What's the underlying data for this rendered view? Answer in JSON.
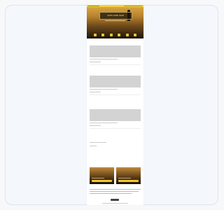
{
  "hero": {
    "title": "EXPLORE MAP"
  },
  "nav": {
    "items": [
      "home-icon",
      "map-icon",
      "calendar-icon",
      "star-icon",
      "food-icon",
      "info-icon"
    ]
  },
  "sections": [
    {
      "title": "",
      "subtitle": "",
      "color": "gray"
    },
    {
      "title": "",
      "subtitle": "",
      "color": "blue"
    },
    {
      "title": "",
      "subtitle": "",
      "color": "dark"
    },
    {
      "title": "",
      "subtitle": "",
      "color": "orange"
    }
  ],
  "colors": {
    "accent": "#f2c62c",
    "topbar": "#f2d43a",
    "map_placeholder": "#d3d3d3"
  }
}
